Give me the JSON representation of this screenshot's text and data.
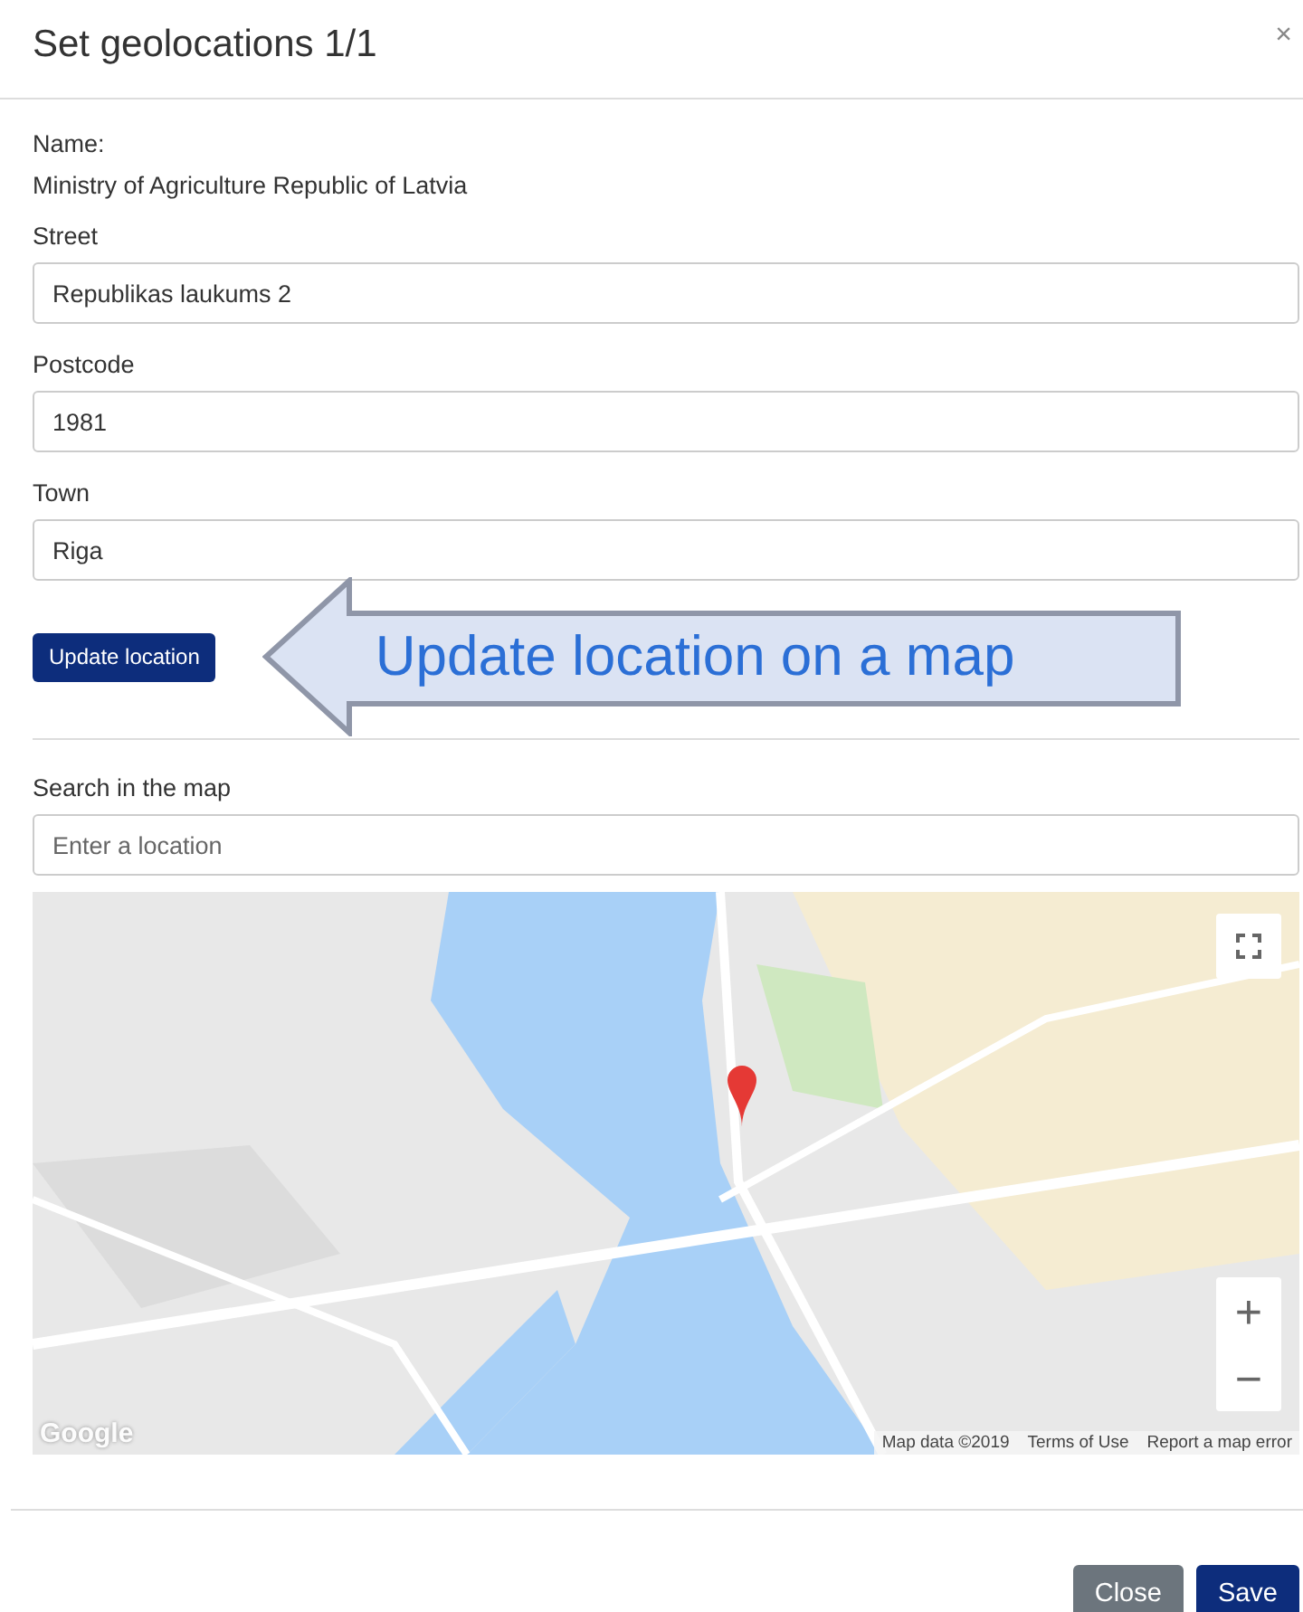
{
  "dialog": {
    "title": "Set geolocations 1/1",
    "close_icon": "×"
  },
  "name": {
    "label": "Name:",
    "value": "Ministry of Agriculture Republic of Latvia"
  },
  "fields": [
    {
      "label": "Street",
      "value": "Republikas laukums 2"
    },
    {
      "label": "Postcode",
      "value": "1981"
    },
    {
      "label": "Town",
      "value": "Riga"
    }
  ],
  "update_button": "Update location",
  "callout": "Update location on a map",
  "search": {
    "label": "Search in the map",
    "placeholder": "Enter a location"
  },
  "map": {
    "zoom_in": "+",
    "zoom_out": "−",
    "logo": "Google",
    "attribution": [
      "Map data ©2019",
      "Terms of Use",
      "Report a map error"
    ]
  },
  "footer": {
    "buttons": [
      {
        "label": "Close",
        "kind": "secondary"
      },
      {
        "label": "Save",
        "kind": "primary"
      }
    ]
  }
}
